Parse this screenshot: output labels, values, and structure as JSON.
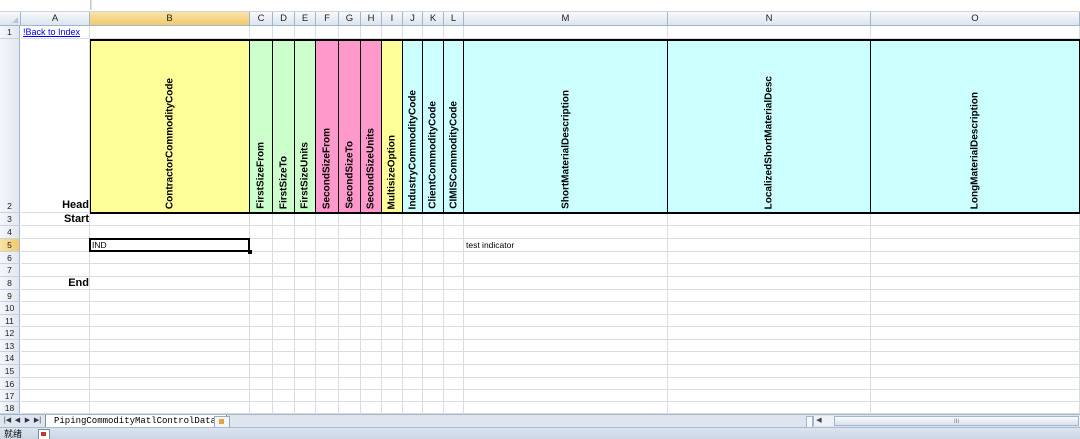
{
  "spreadsheet": {
    "column_letters": [
      "A",
      "B",
      "C",
      "D",
      "E",
      "F",
      "G",
      "H",
      "I",
      "J",
      "K",
      "L",
      "M",
      "N",
      "O"
    ],
    "row_numbers": [
      "1",
      "2",
      "3",
      "4",
      "5",
      "6",
      "7",
      "8",
      "9",
      "10",
      "11",
      "12",
      "13",
      "14",
      "15",
      "16",
      "17",
      "18"
    ],
    "active_column": "B",
    "active_row": "5",
    "back_link": "!Back to Index",
    "row_labels": {
      "head": "Head",
      "start": "Start",
      "end": "End"
    },
    "header_fields": [
      "ContractorCommodityCode",
      "FirstSizeFrom",
      "FirstSizeTo",
      "FirstSizeUnits",
      "SecondSizeFrom",
      "SecondSizeTo",
      "SecondSizeUnits",
      "MultisizeOption",
      "IndustryCommodityCode",
      "ClientCommodityCode",
      "CIMISCommodityCode",
      "ShortMaterialDescription",
      "LocalizedShortMaterialDesc",
      "LongMaterialDescription"
    ],
    "header_colors": [
      "#ffff99",
      "#ccffcc",
      "#ccffcc",
      "#ccffcc",
      "#ff99cc",
      "#ff99cc",
      "#ff99cc",
      "#ffff99",
      "#ccffff",
      "#ccffff",
      "#ccffff",
      "#ccffff",
      "#ccffff",
      "#ccffff"
    ],
    "cells": {
      "B5": "IND",
      "M5": "test indicator"
    }
  },
  "sheet_tabs": {
    "active": "PipingCommodityMatlControlData"
  },
  "status_bar": {
    "text": "就绪"
  },
  "scroll_grip": "III"
}
